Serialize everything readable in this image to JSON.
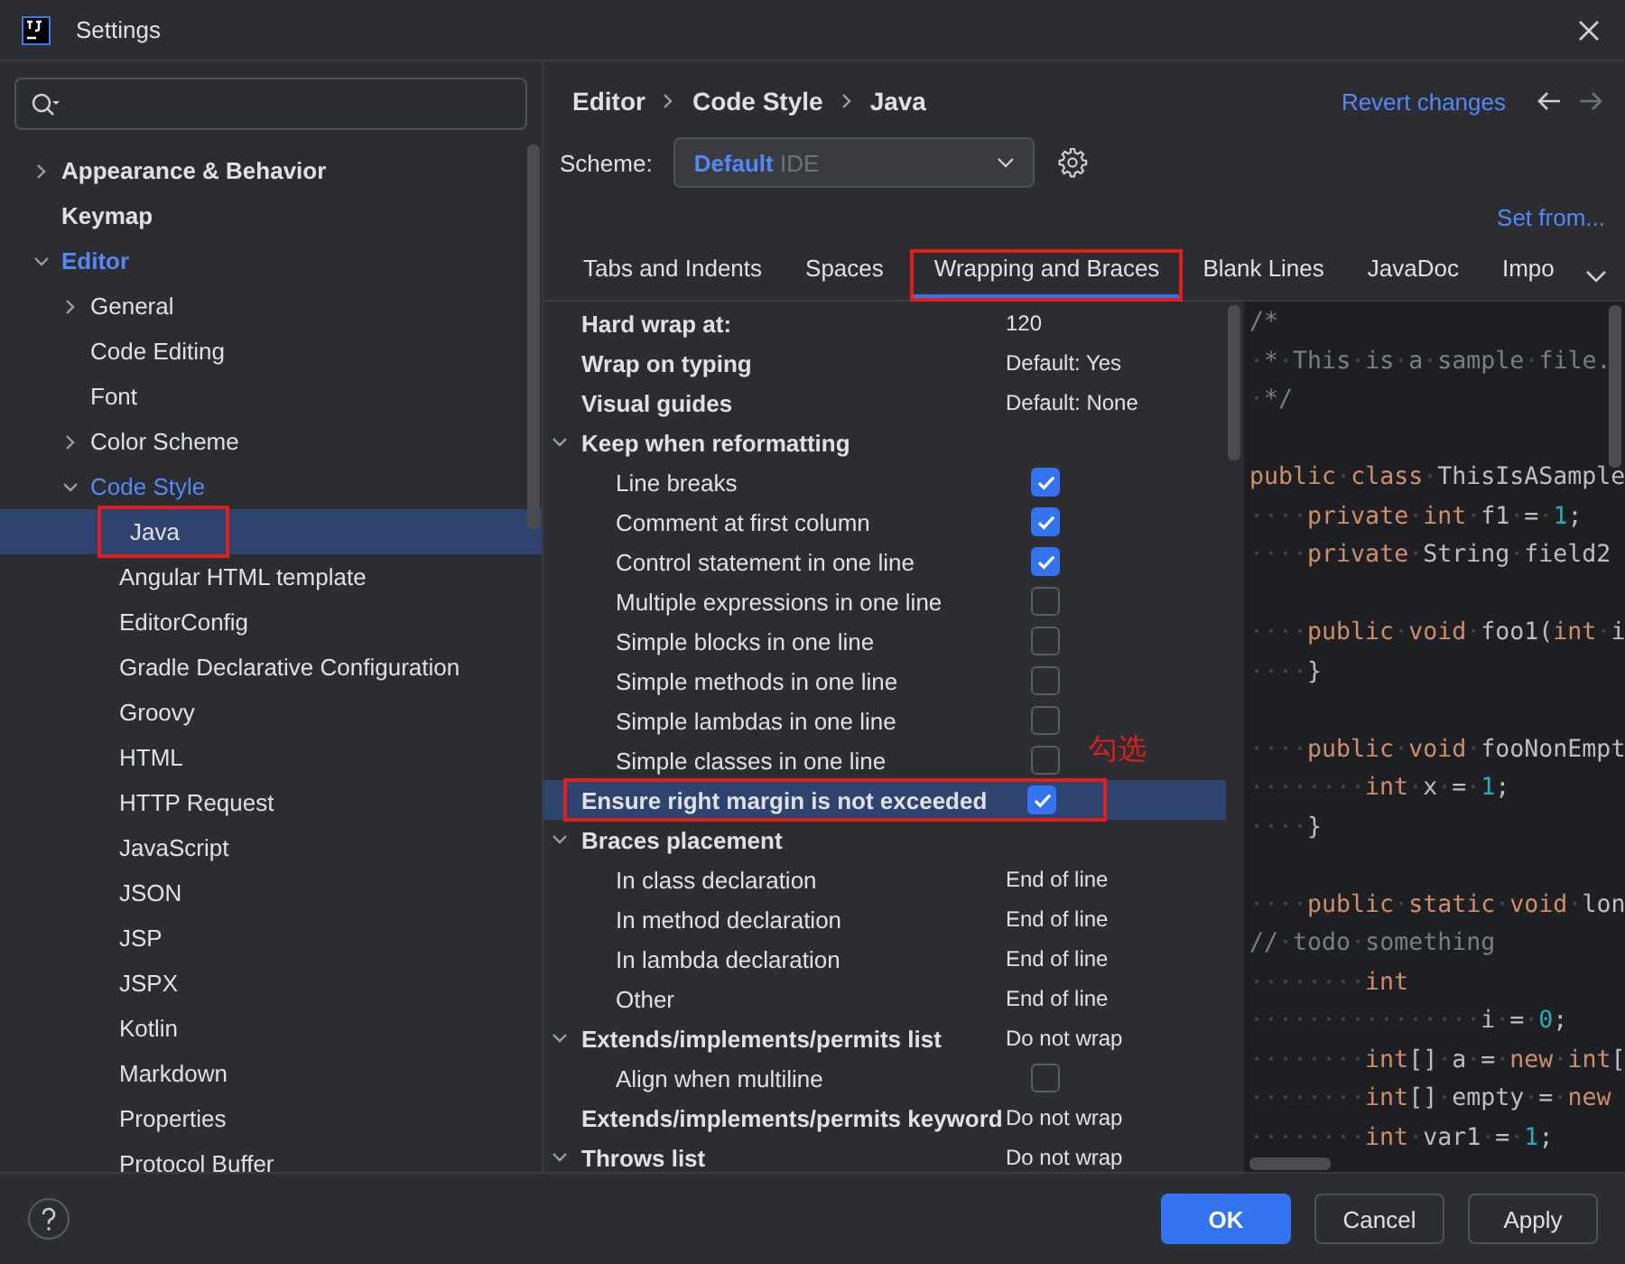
{
  "window": {
    "title": "Settings"
  },
  "tree": [
    {
      "label": "Appearance & Behavior",
      "expanded": false,
      "selected": false
    },
    {
      "label": "Keymap",
      "selected": false
    },
    {
      "label": "Editor",
      "expanded": true,
      "selected": false,
      "children": [
        {
          "label": "General",
          "expanded": false,
          "selected": false
        },
        {
          "label": "Code Editing",
          "selected": false
        },
        {
          "label": "Font",
          "selected": false
        },
        {
          "label": "Color Scheme",
          "expanded": false,
          "selected": false
        },
        {
          "label": "Code Style",
          "expanded": true,
          "selected": false,
          "children": [
            {
              "label": "Java",
              "selected": true,
              "annotated": true
            },
            {
              "label": "Angular HTML template",
              "selected": false
            },
            {
              "label": "EditorConfig",
              "selected": false
            },
            {
              "label": "Gradle Declarative Configuration",
              "selected": false
            },
            {
              "label": "Groovy",
              "selected": false
            },
            {
              "label": "HTML",
              "selected": false
            },
            {
              "label": "HTTP Request",
              "selected": false
            },
            {
              "label": "JavaScript",
              "selected": false
            },
            {
              "label": "JSON",
              "selected": false
            },
            {
              "label": "JSP",
              "selected": false
            },
            {
              "label": "JSPX",
              "selected": false
            },
            {
              "label": "Kotlin",
              "selected": false
            },
            {
              "label": "Markdown",
              "selected": false
            },
            {
              "label": "Properties",
              "selected": false
            },
            {
              "label": "Protocol Buffer",
              "selected": false
            }
          ]
        }
      ]
    }
  ],
  "breadcrumb": [
    "Editor",
    "Code Style",
    "Java"
  ],
  "revert_link": "Revert changes",
  "scheme": {
    "label": "Scheme:",
    "name": "Default",
    "scope": "IDE"
  },
  "set_from_link": "Set from...",
  "tabs": [
    {
      "label": "Tabs and Indents",
      "selected": false
    },
    {
      "label": "Spaces",
      "selected": false
    },
    {
      "label": "Wrapping and Braces",
      "selected": true,
      "annotated": true
    },
    {
      "label": "Blank Lines",
      "selected": false
    },
    {
      "label": "JavaDoc",
      "selected": false
    },
    {
      "label": "Impo",
      "selected": false
    }
  ],
  "options": [
    {
      "kind": "value",
      "label": "Hard wrap at:",
      "value": "120",
      "selected": false
    },
    {
      "kind": "value",
      "label": "Wrap on typing",
      "value": "Default: Yes",
      "selected": false
    },
    {
      "kind": "value",
      "label": "Visual guides",
      "value": "Default: None",
      "selected": false
    },
    {
      "kind": "group",
      "label": "Keep when reformatting",
      "expanded": true,
      "selected": false,
      "children": [
        {
          "kind": "check",
          "label": "Line breaks",
          "checked": true,
          "selected": false
        },
        {
          "kind": "check",
          "label": "Comment at first column",
          "checked": true,
          "selected": false
        },
        {
          "kind": "check",
          "label": "Control statement in one line",
          "checked": true,
          "selected": false
        },
        {
          "kind": "check",
          "label": "Multiple expressions in one line",
          "checked": false,
          "selected": false
        },
        {
          "kind": "check",
          "label": "Simple blocks in one line",
          "checked": false,
          "selected": false
        },
        {
          "kind": "check",
          "label": "Simple methods in one line",
          "checked": false,
          "selected": false
        },
        {
          "kind": "check",
          "label": "Simple lambdas in one line",
          "checked": false,
          "selected": false
        },
        {
          "kind": "check",
          "label": "Simple classes in one line",
          "checked": false,
          "selected": false
        }
      ]
    },
    {
      "kind": "check",
      "label": "Ensure right margin is not exceeded",
      "checked": true,
      "selected": true,
      "annotated": true
    },
    {
      "kind": "group",
      "label": "Braces placement",
      "expanded": true,
      "selected": false,
      "children": [
        {
          "kind": "value",
          "label": "In class declaration",
          "value": "End of line",
          "selected": false
        },
        {
          "kind": "value",
          "label": "In method declaration",
          "value": "End of line",
          "selected": false
        },
        {
          "kind": "value",
          "label": "In lambda declaration",
          "value": "End of line",
          "selected": false
        },
        {
          "kind": "value",
          "label": "Other",
          "value": "End of line",
          "selected": false
        }
      ]
    },
    {
      "kind": "group",
      "label": "Extends/implements/permits list",
      "value": "Do not wrap",
      "expanded": true,
      "selected": false,
      "children": [
        {
          "kind": "check",
          "label": "Align when multiline",
          "checked": false,
          "selected": false
        }
      ]
    },
    {
      "kind": "value",
      "label": "Extends/implements/permits keyword",
      "value": "Do not wrap",
      "selected": false
    },
    {
      "kind": "group",
      "label": "Throws list",
      "value": "Do not wrap",
      "expanded": true,
      "selected": false
    }
  ],
  "annotation_note": "勾选",
  "code": [
    {
      "kind": "code",
      "segments": [
        {
          "kind": "comment",
          "text": "/*"
        }
      ]
    },
    {
      "kind": "code",
      "segments": [
        {
          "kind": "comment",
          "text": "·*·This·is·a·sample·file."
        }
      ]
    },
    {
      "kind": "code",
      "segments": [
        {
          "kind": "comment",
          "text": "·*/"
        }
      ]
    },
    {
      "kind": "blank"
    },
    {
      "kind": "code",
      "segments": [
        {
          "kind": "keyword",
          "text": "public·class·"
        },
        {
          "kind": "plain",
          "text": "ThisIsASample"
        }
      ]
    },
    {
      "kind": "code",
      "segments": [
        {
          "kind": "keyword",
          "text": "····private·int·"
        },
        {
          "kind": "plain",
          "text": "f1·=·"
        },
        {
          "kind": "number",
          "text": "1"
        },
        {
          "kind": "plain",
          "text": ";"
        }
      ]
    },
    {
      "kind": "code",
      "segments": [
        {
          "kind": "keyword",
          "text": "····private·"
        },
        {
          "kind": "plain",
          "text": "String·field2"
        }
      ]
    },
    {
      "kind": "blank"
    },
    {
      "kind": "code",
      "segments": [
        {
          "kind": "keyword",
          "text": "····public·void·"
        },
        {
          "kind": "plain",
          "text": "foo1("
        },
        {
          "kind": "keyword",
          "text": "int"
        },
        {
          "kind": "plain",
          "text": "·i"
        }
      ]
    },
    {
      "kind": "code",
      "segments": [
        {
          "kind": "plain",
          "text": "····}"
        }
      ]
    },
    {
      "kind": "blank"
    },
    {
      "kind": "code",
      "segments": [
        {
          "kind": "keyword",
          "text": "····public·void·"
        },
        {
          "kind": "plain",
          "text": "fooNonEmpt"
        }
      ]
    },
    {
      "kind": "code",
      "segments": [
        {
          "kind": "keyword",
          "text": "········int·"
        },
        {
          "kind": "plain",
          "text": "x·=·"
        },
        {
          "kind": "number",
          "text": "1"
        },
        {
          "kind": "plain",
          "text": ";"
        }
      ]
    },
    {
      "kind": "code",
      "segments": [
        {
          "kind": "plain",
          "text": "····}"
        }
      ]
    },
    {
      "kind": "blank"
    },
    {
      "kind": "code",
      "segments": [
        {
          "kind": "keyword",
          "text": "····public·static·void·"
        },
        {
          "kind": "plain",
          "text": "lon"
        }
      ]
    },
    {
      "kind": "code",
      "segments": [
        {
          "kind": "comment",
          "text": "//·todo·something"
        }
      ]
    },
    {
      "kind": "code",
      "segments": [
        {
          "kind": "keyword",
          "text": "········int"
        }
      ]
    },
    {
      "kind": "code",
      "segments": [
        {
          "kind": "plain",
          "text": "················i·=·"
        },
        {
          "kind": "number",
          "text": "0"
        },
        {
          "kind": "plain",
          "text": ";"
        }
      ]
    },
    {
      "kind": "code",
      "segments": [
        {
          "kind": "keyword",
          "text": "········int"
        },
        {
          "kind": "plain",
          "text": "[]·a·=·"
        },
        {
          "kind": "keyword",
          "text": "new·int"
        },
        {
          "kind": "plain",
          "text": "["
        }
      ]
    },
    {
      "kind": "code",
      "segments": [
        {
          "kind": "keyword",
          "text": "········int"
        },
        {
          "kind": "plain",
          "text": "[]·empty·=·"
        },
        {
          "kind": "keyword",
          "text": "new"
        }
      ]
    },
    {
      "kind": "code",
      "segments": [
        {
          "kind": "keyword",
          "text": "········int·"
        },
        {
          "kind": "plain",
          "text": "var1·=·"
        },
        {
          "kind": "number",
          "text": "1"
        },
        {
          "kind": "plain",
          "text": ";"
        }
      ]
    }
  ],
  "buttons": [
    {
      "kind": "primary",
      "label": "OK"
    },
    {
      "kind": "secondary",
      "label": "Cancel"
    },
    {
      "kind": "secondary",
      "label": "Apply"
    }
  ]
}
